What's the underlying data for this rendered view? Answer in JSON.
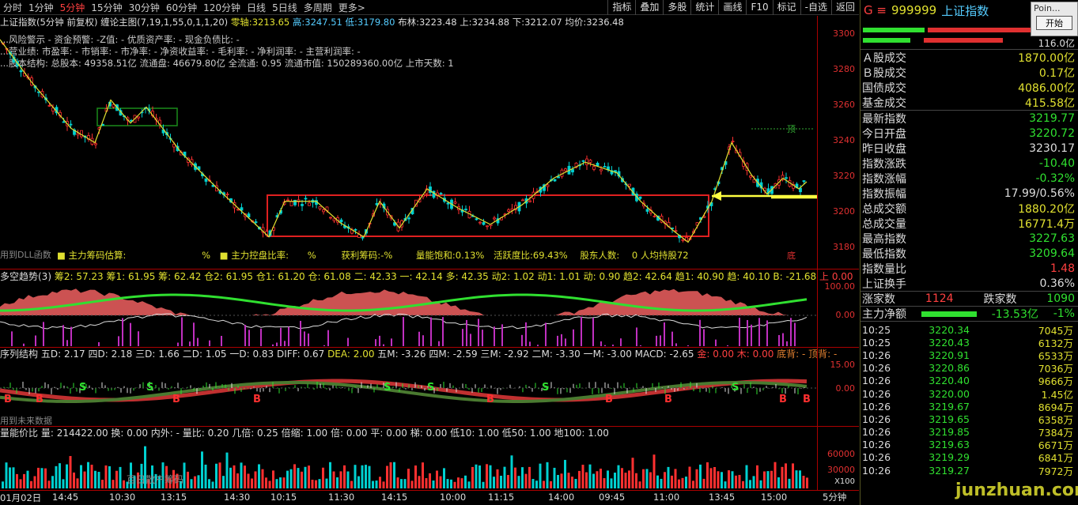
{
  "toolbar": {
    "periods": [
      "分时",
      "1分钟",
      "5分钟",
      "15分钟",
      "30分钟",
      "60分钟",
      "120分钟",
      "日线",
      "5日线",
      "多周期",
      "更多>"
    ],
    "active_period": "5分钟",
    "right_buttons": [
      "指标",
      "叠加",
      "多股",
      "统计",
      "画线",
      "F10",
      "标记",
      "-自选",
      "返回"
    ]
  },
  "main_chart": {
    "title": "上证指数(5分钟 前复权)",
    "formula": "缠论主图(7,19,1,55,0,1,1,20)",
    "zero_axis_label": "零轴:",
    "zero_axis": "3213.65",
    "high_label": "高:",
    "high": "3247.51",
    "low_label": "低:",
    "low": "3179.80",
    "boll_label": "布林:",
    "boll": "3223.48",
    "upper_label": "上:",
    "upper": "3234.88",
    "lower_label": "下:",
    "lower": "3212.07",
    "avg_label": "均价:",
    "avg": "3236.48",
    "info_line1": "...风险警示 - 资金预警:  -Z值:  - 优质资产率:  - 现金负债比: -",
    "info_line2": "...营业绩: 市盈率:  - 市销率:  - 市净率:  - 净资收益率:  - 毛利率:  - 净利润率:  - 主营利润率: -",
    "info_line3": "...股本结构: 总股本: 49358.51亿 流通盘: 46679.80亿 全流通: 0.95 流通市值: 150289360.00亿 上市天数: 1",
    "y_ticks": [
      "3300",
      "3280",
      "3260",
      "3240",
      "3220",
      "3200",
      "3180"
    ],
    "dll_line": "用到DLL函数",
    "chip_est_label": "主力筹码估算:",
    "chip_est": "%",
    "control_label": "主力控盘比率:",
    "control": "%",
    "profit_label": "获利筹码:",
    "profit": "-%",
    "sat_label": "量能饱和:",
    "sat": "0.13%",
    "active_label": "活跃度比:",
    "active": "69.43%",
    "holders_label": "股东人数:",
    "holders": "0 人均持股",
    "holders_extra": "72",
    "top_marker": "顶",
    "bottom_marker": "底"
  },
  "panel2": {
    "name": "多空趋势(3)",
    "values": "筹2: 57.23  筹1: 61.95  筹: 62.42  仓2: 61.95  仓1: 61.20  仓: 61.08  二: 42.33  一: 42.14  多: 42.35  动2: 1.02  动1: 1.01  动: 0.90  趋2: 42.64  趋1: 40.90  趋: 40.10  B: -21.68",
    "tail": "上  0.00",
    "y_ticks": [
      "100.00",
      "0.00"
    ]
  },
  "panel3": {
    "name": "序列结构",
    "values": "五D: 2.17  四D: 2.18  三D: 1.66  二D: 1.05  一D: 0.83  DIFF: 0.67",
    "dea": "DEA: 2.00",
    "values2": "五M: -3.26  四M: -2.59  三M: -2.92  二M: -3.30  一M: -3.00  MACD: -2.65",
    "gold": "金: 0.00  木: 0.00",
    "tail": "底背: -  顶背: -",
    "y_ticks": [
      "15.00",
      "0.00"
    ],
    "footer": "用到未来数据"
  },
  "panel4": {
    "name": "量能价比",
    "values": "量: 214422.00  换: 0.00  内外: -  量比: 0.20  几倍: 0.25  倍缩: 1.00  倍: 0.00  平: 0.00  梯: 0.00  低10: 1.00  低50: 1.00  地100: 1.00",
    "y_ticks": [
      "60000",
      "30000"
    ],
    "unit": "X100",
    "watermark": "百日散户筹码"
  },
  "time_axis": [
    "01月02日",
    "14:45",
    "10:30",
    "13:15",
    "14:30",
    "10:15",
    "11:30",
    "14:15",
    "10:00",
    "11:15",
    "14:00",
    "09:45",
    "11:00",
    "13:45",
    "15:00"
  ],
  "period_badge": "5分钟",
  "right_panel": {
    "code_prefix": "G ≡",
    "code": "999999",
    "name": "上证指数",
    "ratio": "116.0亿",
    "stats": [
      {
        "label": "Ａ股成交",
        "value": "1870.00亿",
        "color": "#e0e030"
      },
      {
        "label": "Ｂ股成交",
        "value": "0.17亿",
        "color": "#e0e030"
      },
      {
        "label": "国债成交",
        "value": "4086.00亿",
        "color": "#e0e030"
      },
      {
        "label": "基金成交",
        "value": "415.58亿",
        "color": "#e0e030"
      }
    ],
    "quote": [
      {
        "label": "最新指数",
        "value": "3219.77",
        "color": "#30e030"
      },
      {
        "label": "今日开盘",
        "value": "3220.72",
        "color": "#30e030"
      },
      {
        "label": "昨日收盘",
        "value": "3230.17",
        "color": "#dddddd"
      },
      {
        "label": "指数涨跌",
        "value": "-10.40",
        "color": "#30e030"
      },
      {
        "label": "指数涨幅",
        "value": "-0.32%",
        "color": "#30e030"
      },
      {
        "label": "指数振幅",
        "value": "17.99/0.56%",
        "color": "#dddddd"
      },
      {
        "label": "总成交额",
        "value": "1880.20亿",
        "color": "#e0e030"
      },
      {
        "label": "总成交量",
        "value": "16771.4万",
        "color": "#e0e030"
      },
      {
        "label": "最高指数",
        "value": "3227.63",
        "color": "#30e030"
      },
      {
        "label": "最低指数",
        "value": "3209.64",
        "color": "#30e030"
      },
      {
        "label": "指数量比",
        "value": "1.48",
        "color": "#ff4040"
      },
      {
        "label": "上证换手",
        "value": "0.36%",
        "color": "#dddddd"
      }
    ],
    "up_label": "涨家数",
    "up": "1124",
    "down_label": "跌家数",
    "down": "1090",
    "flow_label": "主力净额",
    "flow": "-13.53亿",
    "flow_pct": "-1%",
    "ticks": [
      {
        "t": "10:25",
        "p": "3220.34",
        "v": "7045万"
      },
      {
        "t": "10:25",
        "p": "3220.43",
        "v": "6132万"
      },
      {
        "t": "10:26",
        "p": "3220.91",
        "v": "6533万"
      },
      {
        "t": "10:26",
        "p": "3220.86",
        "v": "7036万"
      },
      {
        "t": "10:26",
        "p": "3220.40",
        "v": "9666万"
      },
      {
        "t": "10:26",
        "p": "3220.00",
        "v": "1.45亿"
      },
      {
        "t": "10:26",
        "p": "3219.67",
        "v": "8694万"
      },
      {
        "t": "10:26",
        "p": "3219.65",
        "v": "6358万"
      },
      {
        "t": "10:26",
        "p": "3219.85",
        "v": "7384万"
      },
      {
        "t": "10:26",
        "p": "3219.63",
        "v": "6671万"
      },
      {
        "t": "10:26",
        "p": "3219.29",
        "v": "6841万"
      },
      {
        "t": "10:26",
        "p": "3219.27",
        "v": "7972万"
      }
    ],
    "watermark": "junzhuan.com"
  },
  "popup": {
    "title": "Poin...",
    "button": "开始"
  }
}
